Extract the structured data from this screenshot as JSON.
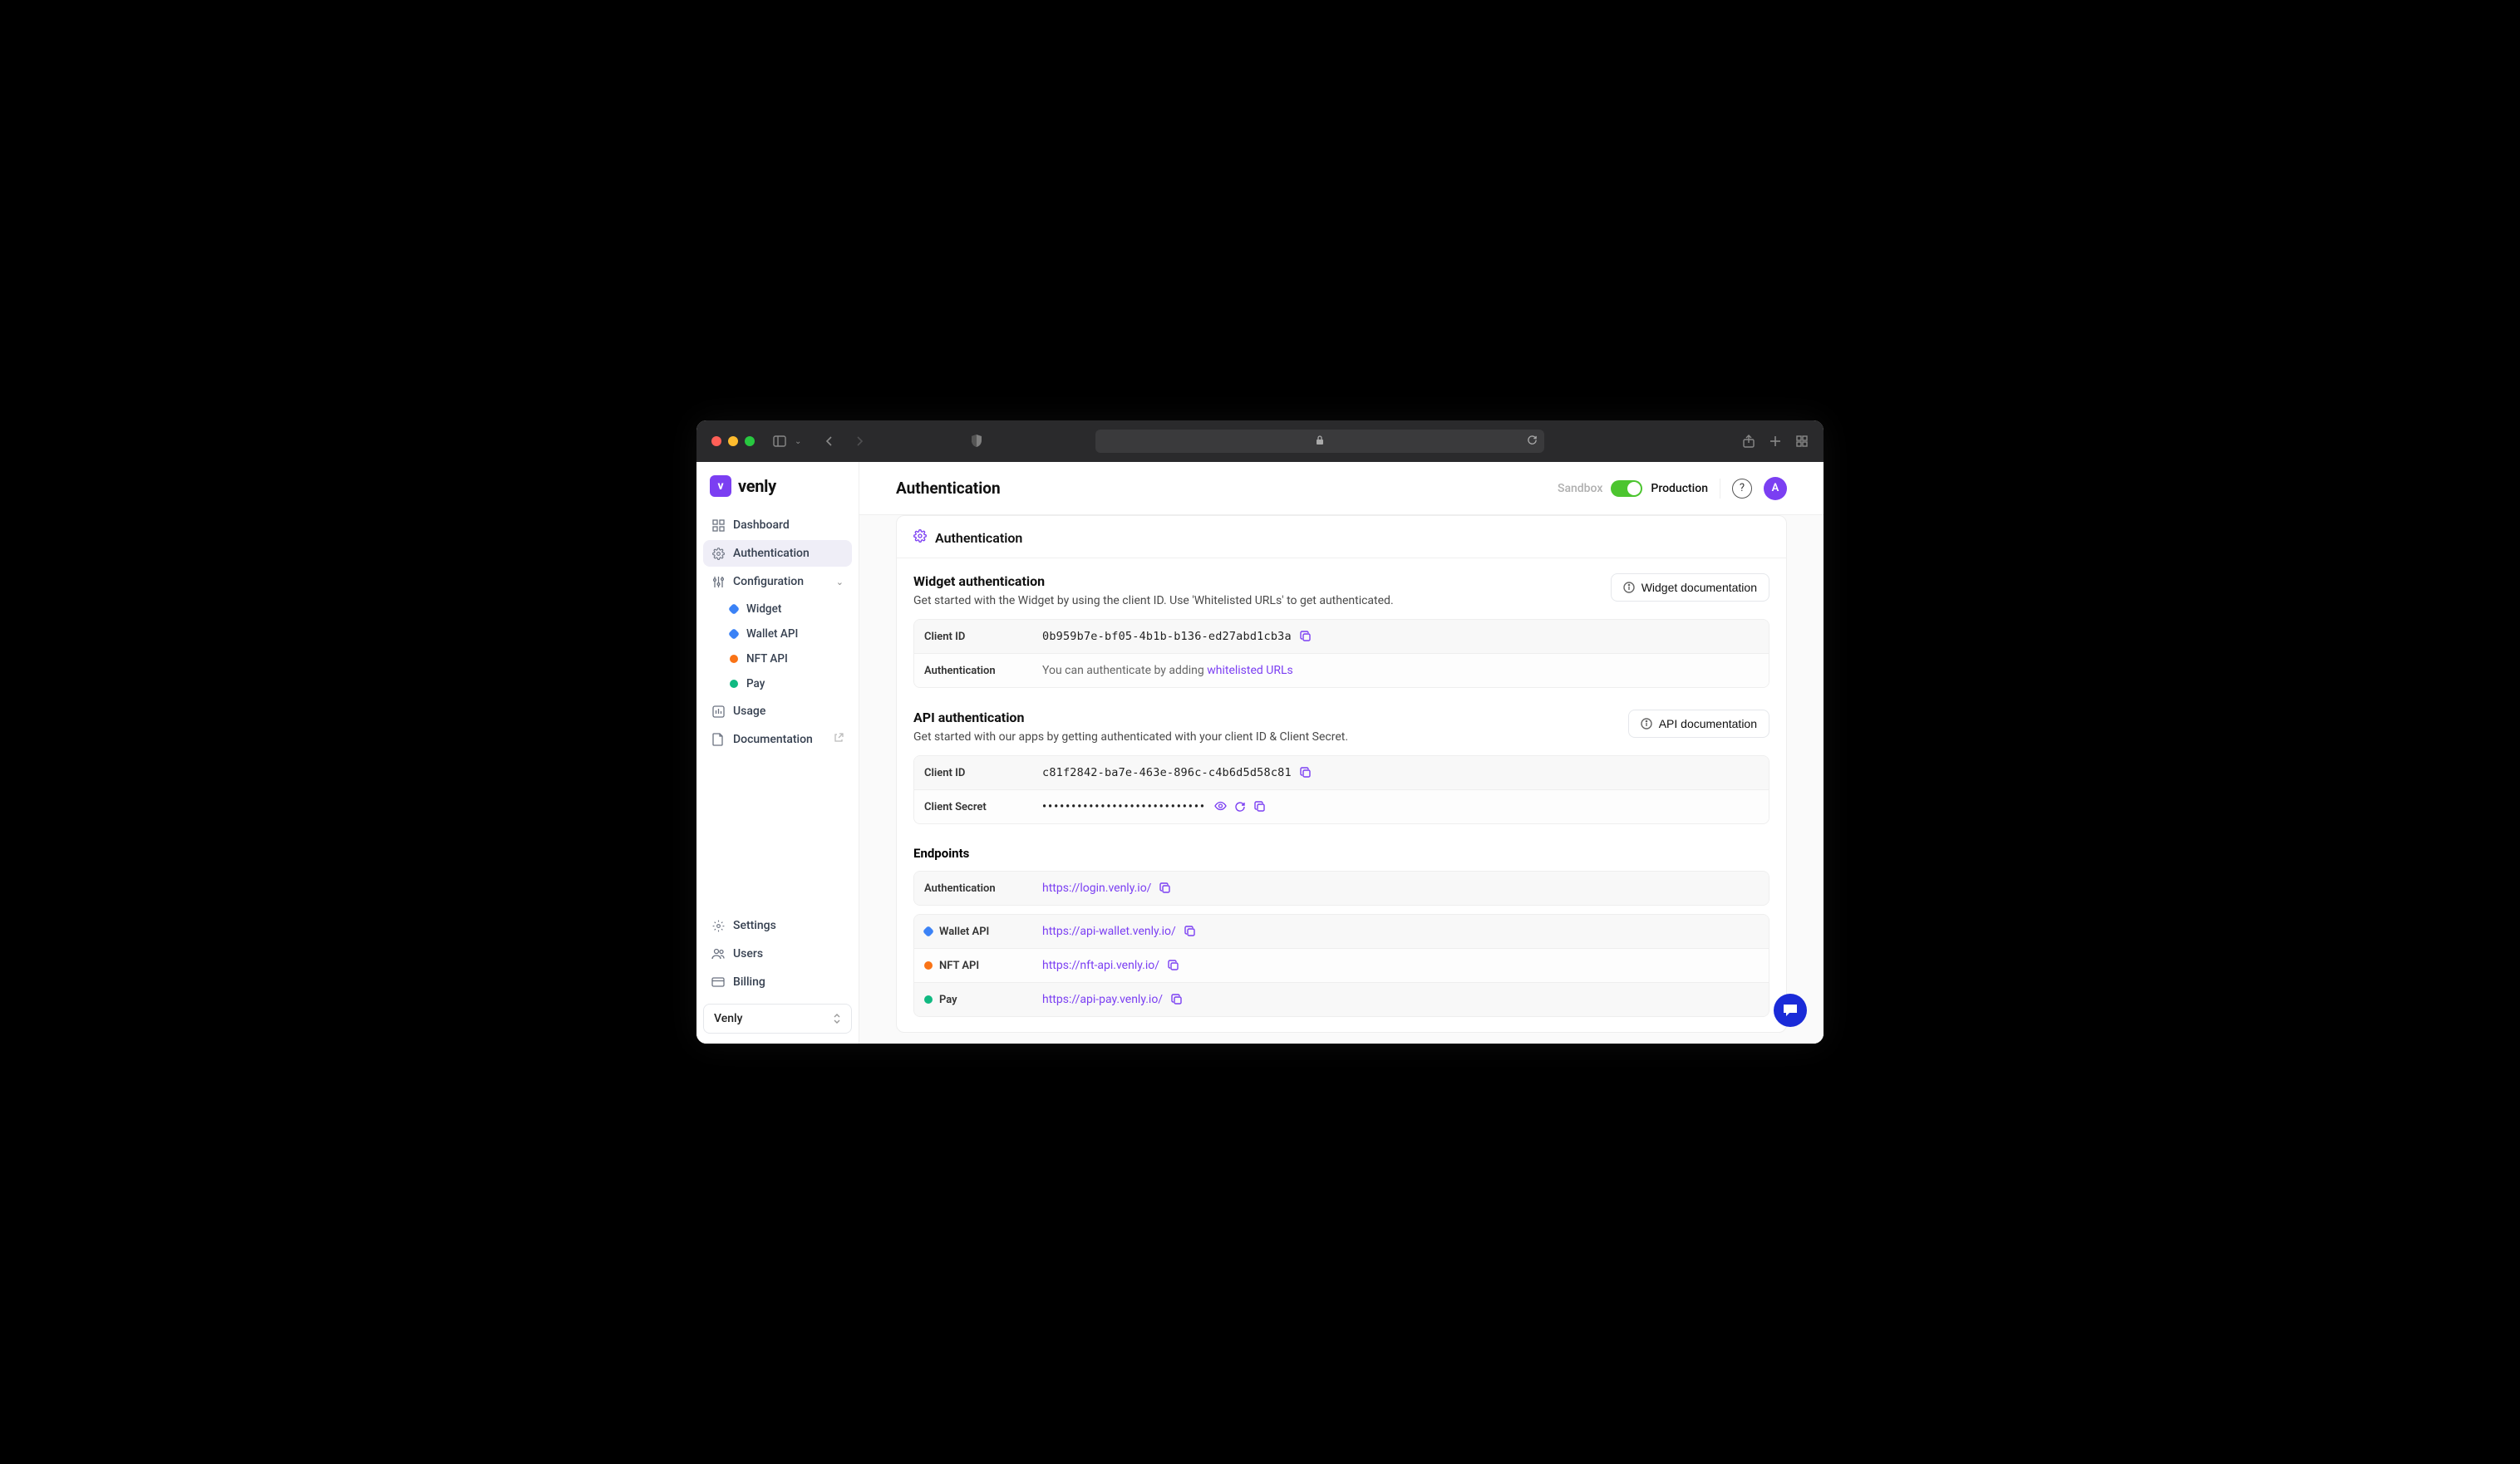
{
  "browser": {
    "url_display": ""
  },
  "brand": {
    "name": "venly"
  },
  "header": {
    "title": "Authentication",
    "sandbox": "Sandbox",
    "production": "Production",
    "avatar_initial": "A"
  },
  "sidebar": {
    "items": [
      {
        "label": "Dashboard"
      },
      {
        "label": "Authentication"
      },
      {
        "label": "Configuration"
      },
      {
        "label": "Usage"
      },
      {
        "label": "Documentation"
      }
    ],
    "config_children": [
      {
        "label": "Widget",
        "color": "#3b82f6",
        "shape": "diamond"
      },
      {
        "label": "Wallet API",
        "color": "#3b82f6",
        "shape": "diamond"
      },
      {
        "label": "NFT API",
        "color": "#f97316",
        "shape": "round"
      },
      {
        "label": "Pay",
        "color": "#10b981",
        "shape": "round"
      }
    ],
    "bottom": [
      {
        "label": "Settings"
      },
      {
        "label": "Users"
      },
      {
        "label": "Billing"
      }
    ],
    "org": "Venly"
  },
  "card": {
    "title": "Authentication"
  },
  "widget_auth": {
    "title": "Widget authentication",
    "desc": "Get started with the Widget by using the client ID. Use 'Whitelisted URLs' to get authenticated.",
    "doc_btn": "Widget documentation",
    "rows": {
      "client_id_label": "Client ID",
      "client_id_value": "0b959b7e-bf05-4b1b-b136-ed27abd1cb3a",
      "auth_label": "Authentication",
      "auth_prefix": "You can authenticate by adding ",
      "auth_link": "whitelisted URLs"
    }
  },
  "api_auth": {
    "title": "API authentication",
    "desc": "Get started with our apps by getting authenticated with your client ID & Client Secret.",
    "doc_btn": "API documentation",
    "rows": {
      "client_id_label": "Client ID",
      "client_id_value": "c81f2842-ba7e-463e-896c-c4b6d5d58c81",
      "secret_label": "Client Secret",
      "secret_value": "••••••••••••••••••••••••••••"
    }
  },
  "endpoints": {
    "title": "Endpoints",
    "rows": [
      {
        "label": "Authentication",
        "url": "https://login.venly.io/",
        "color": "",
        "shape": ""
      },
      {
        "label": "Wallet API",
        "url": "https://api-wallet.venly.io/",
        "color": "#3b82f6",
        "shape": "diamond"
      },
      {
        "label": "NFT API",
        "url": "https://nft-api.venly.io/",
        "color": "#f97316",
        "shape": "round"
      },
      {
        "label": "Pay",
        "url": "https://api-pay.venly.io/",
        "color": "#10b981",
        "shape": "round"
      }
    ]
  }
}
